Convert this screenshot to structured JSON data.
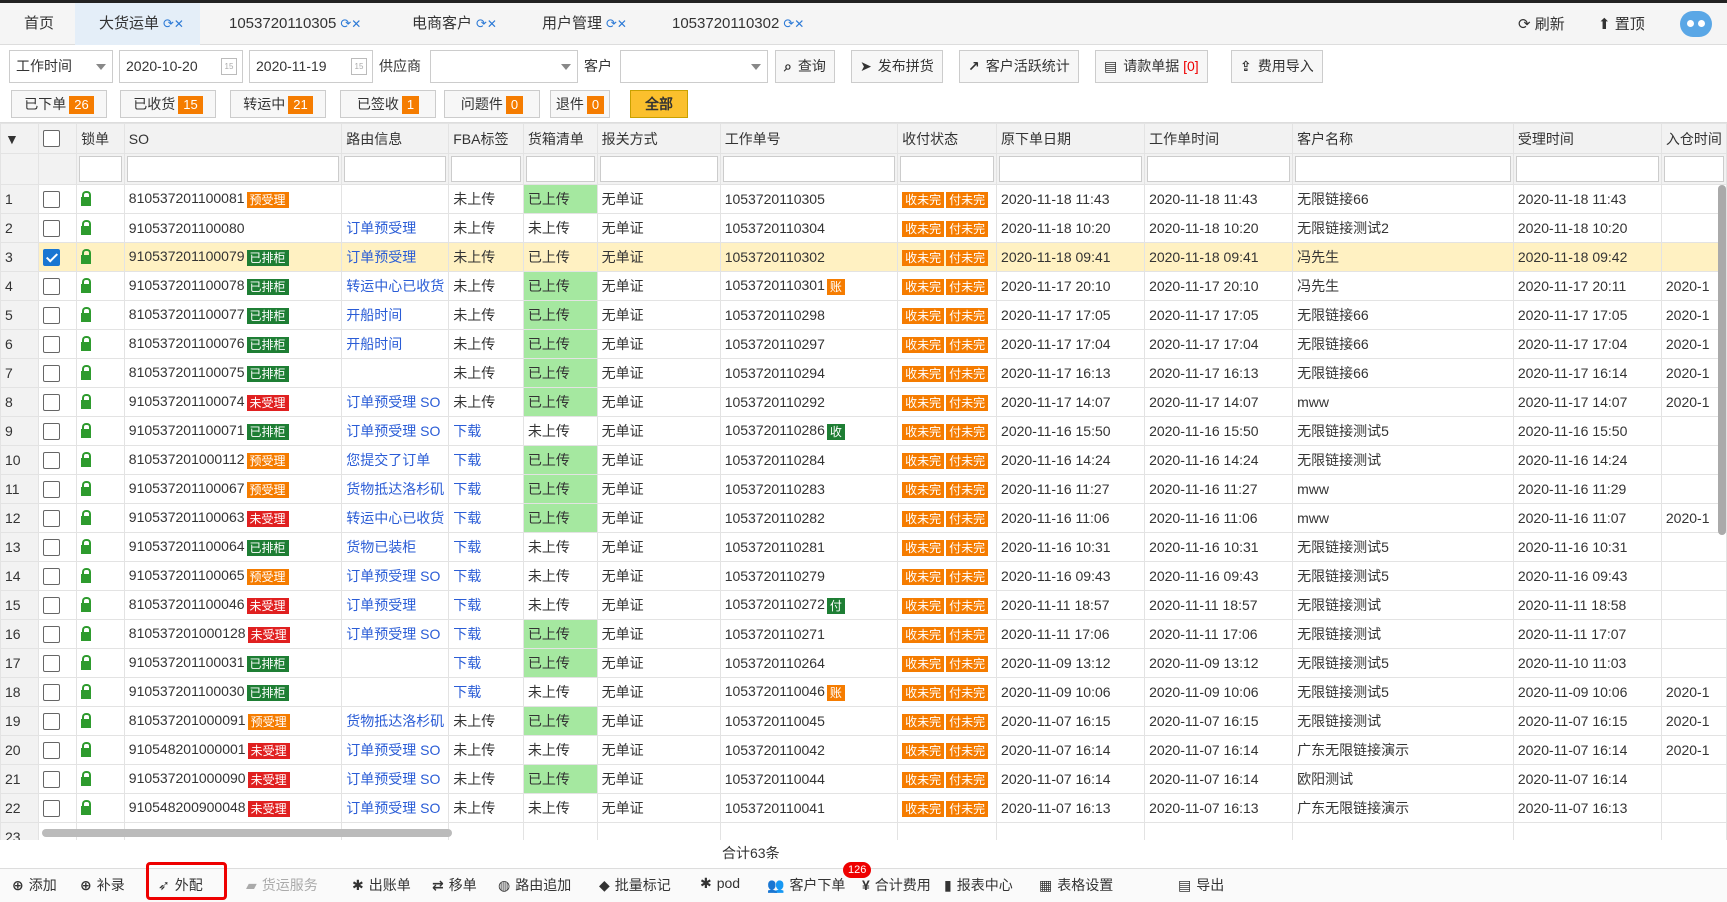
{
  "tabs": [
    {
      "label": "首页",
      "refresh": false
    },
    {
      "label": "大货运单",
      "refresh": true,
      "active": true
    },
    {
      "label": "1053720110305",
      "refresh": true
    },
    {
      "label": "电商客户",
      "refresh": true
    },
    {
      "label": "用户管理",
      "refresh": true
    },
    {
      "label": "1053720110302",
      "refresh": true
    }
  ],
  "top_actions": {
    "refresh": "刷新",
    "top": "置顶"
  },
  "filters": {
    "time_type": "工作时间",
    "date_from": "2020-10-20",
    "date_to": "2020-11-19",
    "supplier_label": "供应商",
    "supplier_value": "",
    "customer_label": "客户",
    "customer_value": ""
  },
  "toolbar": {
    "query": "查询",
    "publish": "发布拼货",
    "stats": "客户活跃统计",
    "payment_request": "请款单据",
    "payment_count": "[0]",
    "fee_import": "费用导入"
  },
  "status_buttons": [
    {
      "label": "已下单",
      "count": "26"
    },
    {
      "label": "已收货",
      "count": "15"
    },
    {
      "label": "转运中",
      "count": "21"
    },
    {
      "label": "已签收",
      "count": "1"
    },
    {
      "label": "问题件",
      "count": "0"
    },
    {
      "label": "退件",
      "count": "0"
    },
    {
      "label": "全部",
      "count": ""
    }
  ],
  "columns": [
    "锁单",
    "SO",
    "路由信息",
    "FBA标签",
    "货箱清单",
    "报关方式",
    "工作单号",
    "收付状态",
    "原下单日期",
    "工作单时间",
    "客户名称",
    "受理时间",
    "入仓时间"
  ],
  "rows": [
    {
      "n": "1",
      "so": "810537201100081",
      "tag": "预受理",
      "tc": "orange",
      "route": "",
      "fba": "未上传",
      "box": "已上传",
      "customs": "无单证",
      "work": "1053720110305",
      "wtag": "",
      "wtc": "",
      "pay": [
        "收未完",
        "付未完"
      ],
      "orig": "2020-11-18 11:43",
      "wtime": "2020-11-18 11:43",
      "cust": "无限链接66",
      "acc": "2020-11-18 11:43",
      "inw": ""
    },
    {
      "n": "2",
      "so": "910537201100080",
      "tag": "",
      "tc": "",
      "route": "订单预受理",
      "fba": "未上传",
      "box": "未上传",
      "customs": "无单证",
      "work": "1053720110304",
      "wtag": "",
      "wtc": "",
      "pay": [
        "收未完",
        "付未完"
      ],
      "orig": "2020-11-18 10:20",
      "wtime": "2020-11-18 10:20",
      "cust": "无限链接测试2",
      "acc": "2020-11-18 10:20",
      "inw": ""
    },
    {
      "n": "3",
      "so": "910537201100079",
      "tag": "已排柜",
      "tc": "green",
      "route": "订单预受理",
      "fba": "未上传",
      "box": "已上传",
      "customs": "无单证",
      "work": "1053720110302",
      "wtag": "",
      "wtc": "",
      "pay": [
        "收未完",
        "付未完"
      ],
      "orig": "2020-11-18 09:41",
      "wtime": "2020-11-18 09:41",
      "cust": "冯先生",
      "acc": "2020-11-18 09:42",
      "inw": "",
      "selected": true
    },
    {
      "n": "4",
      "so": "910537201100078",
      "tag": "已排柜",
      "tc": "green",
      "route": "转运中心已收货",
      "fba": "未上传",
      "box": "已上传",
      "customs": "无单证",
      "work": "1053720110301",
      "wtag": "账",
      "wtc": "orange",
      "pay": [
        "收未完",
        "付未完"
      ],
      "orig": "2020-11-17 20:10",
      "wtime": "2020-11-17 20:10",
      "cust": "冯先生",
      "acc": "2020-11-17 20:11",
      "inw": "2020-1"
    },
    {
      "n": "5",
      "so": "810537201100077",
      "tag": "已排柜",
      "tc": "green",
      "route": "开船时间",
      "fba": "未上传",
      "box": "已上传",
      "customs": "无单证",
      "work": "1053720110298",
      "wtag": "",
      "wtc": "",
      "pay": [
        "收未完",
        "付未完"
      ],
      "orig": "2020-11-17 17:05",
      "wtime": "2020-11-17 17:05",
      "cust": "无限链接66",
      "acc": "2020-11-17 17:05",
      "inw": "2020-1"
    },
    {
      "n": "6",
      "so": "810537201100076",
      "tag": "已排柜",
      "tc": "green",
      "route": "开船时间",
      "fba": "未上传",
      "box": "已上传",
      "customs": "无单证",
      "work": "1053720110297",
      "wtag": "",
      "wtc": "",
      "pay": [
        "收未完",
        "付未完"
      ],
      "orig": "2020-11-17 17:04",
      "wtime": "2020-11-17 17:04",
      "cust": "无限链接66",
      "acc": "2020-11-17 17:04",
      "inw": "2020-1"
    },
    {
      "n": "7",
      "so": "810537201100075",
      "tag": "已排柜",
      "tc": "green",
      "route": "",
      "fba": "未上传",
      "box": "已上传",
      "customs": "无单证",
      "work": "1053720110294",
      "wtag": "",
      "wtc": "",
      "pay": [
        "收未完",
        "付未完"
      ],
      "orig": "2020-11-17 16:13",
      "wtime": "2020-11-17 16:13",
      "cust": "无限链接66",
      "acc": "2020-11-17 16:14",
      "inw": "2020-1"
    },
    {
      "n": "8",
      "so": "910537201100074",
      "tag": "未受理",
      "tc": "red",
      "route": "订单预受理 SO",
      "fba": "未上传",
      "box": "已上传",
      "customs": "无单证",
      "work": "1053720110292",
      "wtag": "",
      "wtc": "",
      "pay": [
        "收未完",
        "付未完"
      ],
      "orig": "2020-11-17 14:07",
      "wtime": "2020-11-17 14:07",
      "cust": "mww",
      "acc": "2020-11-17 14:07",
      "inw": "2020-1"
    },
    {
      "n": "9",
      "so": "910537201100071",
      "tag": "已排柜",
      "tc": "green",
      "route": "订单预受理 SO",
      "fba": "下载",
      "box": "未上传",
      "customs": "无单证",
      "work": "1053720110286",
      "wtag": "收",
      "wtc": "green",
      "pay": [
        "收未完",
        "付未完"
      ],
      "orig": "2020-11-16 15:50",
      "wtime": "2020-11-16 15:50",
      "cust": "无限链接测试5",
      "acc": "2020-11-16 15:50",
      "inw": ""
    },
    {
      "n": "10",
      "so": "810537201000112",
      "tag": "预受理",
      "tc": "orange",
      "route": "您提交了订单",
      "fba": "下载",
      "box": "已上传",
      "customs": "无单证",
      "work": "1053720110284",
      "wtag": "",
      "wtc": "",
      "pay": [
        "收未完",
        "付未完"
      ],
      "orig": "2020-11-16 14:24",
      "wtime": "2020-11-16 14:24",
      "cust": "无限链接测试",
      "acc": "2020-11-16 14:24",
      "inw": ""
    },
    {
      "n": "11",
      "so": "910537201100067",
      "tag": "预受理",
      "tc": "orange",
      "route": "货物抵达洛杉矶",
      "fba": "下载",
      "box": "已上传",
      "customs": "无单证",
      "work": "1053720110283",
      "wtag": "",
      "wtc": "",
      "pay": [
        "收未完",
        "付未完"
      ],
      "orig": "2020-11-16 11:27",
      "wtime": "2020-11-16 11:27",
      "cust": "mww",
      "acc": "2020-11-16 11:29",
      "inw": ""
    },
    {
      "n": "12",
      "so": "910537201100063",
      "tag": "未受理",
      "tc": "red",
      "route": "转运中心已收货",
      "fba": "下载",
      "box": "已上传",
      "customs": "无单证",
      "work": "1053720110282",
      "wtag": "",
      "wtc": "",
      "pay": [
        "收未完",
        "付未完"
      ],
      "orig": "2020-11-16 11:06",
      "wtime": "2020-11-16 11:06",
      "cust": "mww",
      "acc": "2020-11-16 11:07",
      "inw": "2020-1"
    },
    {
      "n": "13",
      "so": "910537201100064",
      "tag": "已排柜",
      "tc": "green",
      "route": "货物已装柜",
      "fba": "下载",
      "box": "未上传",
      "customs": "无单证",
      "work": "1053720110281",
      "wtag": "",
      "wtc": "",
      "pay": [
        "收未完",
        "付未完"
      ],
      "orig": "2020-11-16 10:31",
      "wtime": "2020-11-16 10:31",
      "cust": "无限链接测试5",
      "acc": "2020-11-16 10:31",
      "inw": ""
    },
    {
      "n": "14",
      "so": "910537201100065",
      "tag": "预受理",
      "tc": "orange",
      "route": "订单预受理 SO",
      "fba": "下载",
      "box": "未上传",
      "customs": "无单证",
      "work": "1053720110279",
      "wtag": "",
      "wtc": "",
      "pay": [
        "收未完",
        "付未完"
      ],
      "orig": "2020-11-16 09:43",
      "wtime": "2020-11-16 09:43",
      "cust": "无限链接测试5",
      "acc": "2020-11-16 09:43",
      "inw": ""
    },
    {
      "n": "15",
      "so": "810537201100046",
      "tag": "未受理",
      "tc": "red",
      "route": "订单预受理",
      "fba": "下载",
      "box": "未上传",
      "customs": "无单证",
      "work": "1053720110272",
      "wtag": "付",
      "wtc": "green",
      "pay": [
        "收未完",
        "付未完"
      ],
      "orig": "2020-11-11 18:57",
      "wtime": "2020-11-11 18:57",
      "cust": "无限链接测试",
      "acc": "2020-11-11 18:58",
      "inw": ""
    },
    {
      "n": "16",
      "so": "810537201000128",
      "tag": "未受理",
      "tc": "red",
      "route": "订单预受理 SO",
      "fba": "下载",
      "box": "已上传",
      "customs": "无单证",
      "work": "1053720110271",
      "wtag": "",
      "wtc": "",
      "pay": [
        "收未完",
        "付未完"
      ],
      "orig": "2020-11-11 17:06",
      "wtime": "2020-11-11 17:06",
      "cust": "无限链接测试",
      "acc": "2020-11-11 17:07",
      "inw": ""
    },
    {
      "n": "17",
      "so": "910537201100031",
      "tag": "已排柜",
      "tc": "green",
      "route": "",
      "fba": "下载",
      "box": "已上传",
      "customs": "无单证",
      "work": "1053720110264",
      "wtag": "",
      "wtc": "",
      "pay": [
        "收未完",
        "付未完"
      ],
      "orig": "2020-11-09 13:12",
      "wtime": "2020-11-09 13:12",
      "cust": "无限链接测试5",
      "acc": "2020-11-10 11:03",
      "inw": ""
    },
    {
      "n": "18",
      "so": "910537201100030",
      "tag": "已排柜",
      "tc": "green",
      "route": "",
      "fba": "下载",
      "box": "未上传",
      "customs": "无单证",
      "work": "1053720110046",
      "wtag": "账",
      "wtc": "orange",
      "pay": [
        "收未完",
        "付未完"
      ],
      "orig": "2020-11-09 10:06",
      "wtime": "2020-11-09 10:06",
      "cust": "无限链接测试5",
      "acc": "2020-11-09 10:06",
      "inw": "2020-1"
    },
    {
      "n": "19",
      "so": "810537201000091",
      "tag": "预受理",
      "tc": "orange",
      "route": "货物抵达洛杉矶",
      "fba": "未上传",
      "box": "已上传",
      "customs": "无单证",
      "work": "1053720110045",
      "wtag": "",
      "wtc": "",
      "pay": [
        "收未完",
        "付未完"
      ],
      "orig": "2020-11-07 16:15",
      "wtime": "2020-11-07 16:15",
      "cust": "无限链接测试",
      "acc": "2020-11-07 16:15",
      "inw": "2020-1"
    },
    {
      "n": "20",
      "so": "910548201000001",
      "tag": "未受理",
      "tc": "red",
      "route": "订单预受理 SO",
      "fba": "未上传",
      "box": "未上传",
      "customs": "无单证",
      "work": "1053720110042",
      "wtag": "",
      "wtc": "",
      "pay": [
        "收未完",
        "付未完"
      ],
      "orig": "2020-11-07 16:14",
      "wtime": "2020-11-07 16:14",
      "cust": "广东无限链接演示",
      "acc": "2020-11-07 16:14",
      "inw": "2020-1"
    },
    {
      "n": "21",
      "so": "910537201000090",
      "tag": "未受理",
      "tc": "red",
      "route": "订单预受理 SO",
      "fba": "未上传",
      "box": "已上传",
      "customs": "无单证",
      "work": "1053720110044",
      "wtag": "",
      "wtc": "",
      "pay": [
        "收未完",
        "付未完"
      ],
      "orig": "2020-11-07 16:14",
      "wtime": "2020-11-07 16:14",
      "cust": "欧阳测试",
      "acc": "2020-11-07 16:14",
      "inw": ""
    },
    {
      "n": "22",
      "so": "910548200900048",
      "tag": "未受理",
      "tc": "red",
      "route": "订单预受理 SO",
      "fba": "未上传",
      "box": "未上传",
      "customs": "无单证",
      "work": "1053720110041",
      "wtag": "",
      "wtc": "",
      "pay": [
        "收未完",
        "付未完"
      ],
      "orig": "2020-11-07 16:13",
      "wtime": "2020-11-07 16:13",
      "cust": "广东无限链接演示",
      "acc": "2020-11-07 16:13",
      "inw": ""
    },
    {
      "n": "23",
      "so": "",
      "tag": "",
      "tc": "",
      "route": "",
      "fba": "",
      "box": "",
      "customs": "",
      "work": "",
      "wtag": "",
      "wtc": "",
      "pay": [],
      "orig": "",
      "wtime": "",
      "cust": "",
      "acc": "",
      "inw": ""
    }
  ],
  "total": "合计63条",
  "bottom_actions": [
    {
      "label": "添加",
      "icon": "plus-circle-icon",
      "glyph": "⊕",
      "disabled": false
    },
    {
      "label": "补录",
      "icon": "plus-circle-icon",
      "glyph": "⊕",
      "disabled": false
    },
    {
      "label": "外配",
      "icon": "rocket-icon",
      "glyph": "➶",
      "disabled": false
    },
    {
      "label": "货运服务",
      "icon": "truck-icon",
      "glyph": "▰",
      "disabled": true
    },
    {
      "label": "出账单",
      "icon": "gear-icon",
      "glyph": "✱",
      "disabled": false
    },
    {
      "label": "移单",
      "icon": "swap-icon",
      "glyph": "⇄",
      "disabled": false
    },
    {
      "label": "路由追加",
      "icon": "globe-icon",
      "glyph": "◍",
      "disabled": false
    },
    {
      "label": "批量标记",
      "icon": "tag-icon",
      "glyph": "◆",
      "disabled": false
    },
    {
      "label": "pod",
      "icon": "gear-icon",
      "glyph": "✱",
      "disabled": false
    },
    {
      "label": "客户下单",
      "icon": "users-icon",
      "glyph": "👥",
      "disabled": false
    },
    {
      "label": "合计费用",
      "icon": "yen-icon",
      "glyph": "¥",
      "disabled": false
    },
    {
      "label": "报表中心",
      "icon": "bar-chart-icon",
      "glyph": "▮",
      "disabled": false
    },
    {
      "label": "表格设置",
      "icon": "table-icon",
      "glyph": "▦",
      "disabled": false
    },
    {
      "label": "导出",
      "icon": "file-icon",
      "glyph": "▤",
      "disabled": false
    }
  ],
  "customer_order_badge": "126",
  "colors": {
    "accent": "#1976d2",
    "orange": "#f57c00",
    "green": "#1e7e34",
    "red": "#e02020",
    "uploaded": "#a5e8a0",
    "selected_row": "#fff1c2"
  }
}
